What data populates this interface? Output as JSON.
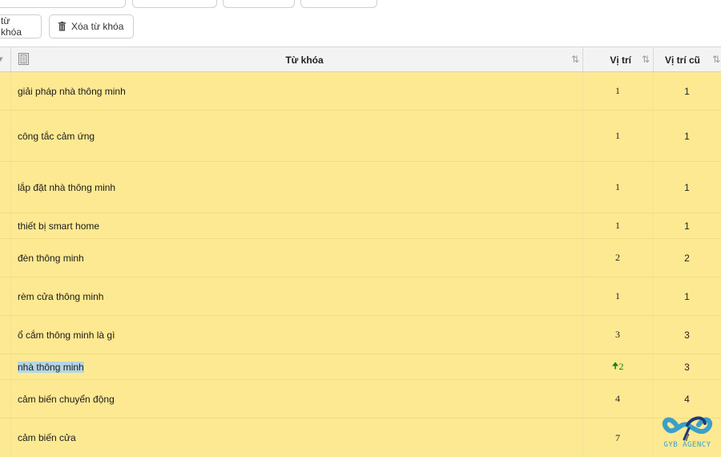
{
  "toolbar": {
    "add_keyword_label": "từ khóa",
    "delete_keyword_label": "Xóa từ khóa",
    "trash_icon": "trash-icon"
  },
  "table": {
    "headers": {
      "keyword": "Từ khóa",
      "position": "Vị trí",
      "old_position": "Vị trí cũ"
    },
    "rows": [
      {
        "keyword": "giải pháp nhà thông minh",
        "position": "1",
        "old_position": "1"
      },
      {
        "keyword": "công tắc cảm ứng",
        "position": "1",
        "old_position": "1"
      },
      {
        "keyword": "lắp đặt nhà thông minh",
        "position": "1",
        "old_position": "1"
      },
      {
        "keyword": "thiết bị smart home",
        "position": "1",
        "old_position": "1"
      },
      {
        "keyword": "đèn thông minh",
        "position": "2",
        "old_position": "2"
      },
      {
        "keyword": "rèm cửa thông minh",
        "position": "1",
        "old_position": "1"
      },
      {
        "keyword": "ổ cắm thông minh là gì",
        "position": "3",
        "old_position": "3"
      },
      {
        "keyword": "nhà thông minh",
        "position": "2",
        "old_position": "3",
        "trend": "up"
      },
      {
        "keyword": "cảm biến chuyển động",
        "position": "4",
        "old_position": "4"
      },
      {
        "keyword": "cảm biến cửa",
        "position": "7",
        "old_position": "7"
      }
    ]
  },
  "colors": {
    "row_bg": "#fde992",
    "header_bg": "#f3f3f3",
    "trend_up": "#1a7a1a",
    "highlight": "#b5d6e4"
  },
  "watermark": {
    "text": "GYB AGENCY"
  }
}
